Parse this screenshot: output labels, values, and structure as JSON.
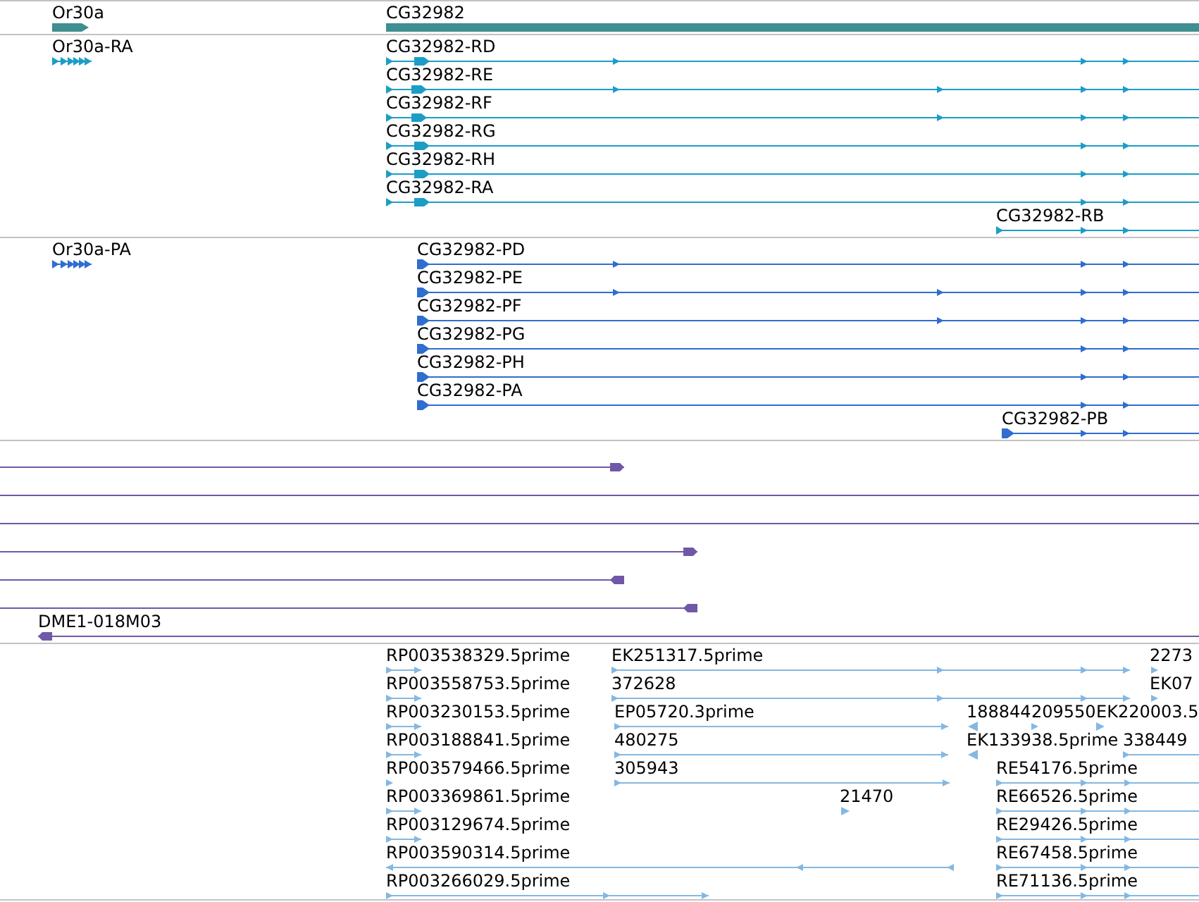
{
  "tracks": [
    {
      "kind": "gene",
      "features": [
        {
          "label": "Or30a"
        },
        {
          "label": "CG32982"
        }
      ]
    },
    {
      "kind": "transcript",
      "features": [
        {
          "label": "Or30a-RA"
        },
        {
          "label": "CG32982-RD"
        },
        {
          "label": "CG32982-RE"
        },
        {
          "label": "CG32982-RF"
        },
        {
          "label": "CG32982-RG"
        },
        {
          "label": "CG32982-RH"
        },
        {
          "label": "CG32982-RA"
        },
        {
          "label": "CG32982-RB"
        }
      ]
    },
    {
      "kind": "protein",
      "features": [
        {
          "label": "Or30a-PA"
        },
        {
          "label": "CG32982-PD"
        },
        {
          "label": "CG32982-PE"
        },
        {
          "label": "CG32982-PF"
        },
        {
          "label": "CG32982-PG"
        },
        {
          "label": "CG32982-PH"
        },
        {
          "label": "CG32982-PA"
        },
        {
          "label": "CG32982-PB"
        }
      ]
    },
    {
      "kind": "clone",
      "features": [
        {
          "kind": "forward"
        },
        {
          "kind": "through"
        },
        {
          "kind": "through"
        },
        {
          "kind": "forward"
        },
        {
          "kind": "reverse"
        },
        {
          "kind": "reverse"
        },
        {
          "kind": "reverse",
          "label": "DME1-018M03"
        }
      ]
    },
    {
      "kind": "est",
      "features": [
        {
          "kind": "forward",
          "label": "RP003538329.5prime"
        },
        {
          "kind": "forward",
          "label": "EK251317.5prime"
        },
        {
          "kind": "forward",
          "label": "2273"
        },
        {
          "kind": "forward",
          "label": "RP003558753.5prime"
        },
        {
          "kind": "forward",
          "label": "372628"
        },
        {
          "kind": "forward",
          "label": "EK07"
        },
        {
          "kind": "forward",
          "label": "RP003230153.5prime"
        },
        {
          "kind": "forward",
          "label": "EP05720.3prime"
        },
        {
          "kind": "reverse",
          "label": "188844"
        },
        {
          "kind": "forward",
          "label": "209550"
        },
        {
          "kind": "forward",
          "label": "EK220003.5"
        },
        {
          "kind": "forward",
          "label": "RP003188841.5prime"
        },
        {
          "kind": "forward",
          "label": "480275"
        },
        {
          "kind": "reverse",
          "label": "EK133938.5prime"
        },
        {
          "kind": "forward",
          "label": "338449"
        },
        {
          "kind": "forward",
          "label": "RP003579466.5prime"
        },
        {
          "kind": "forward",
          "label": "305943"
        },
        {
          "kind": "forward",
          "label": "RE54176.5prime"
        },
        {
          "kind": "forward",
          "label": "RP003369861.5prime"
        },
        {
          "kind": "forward",
          "label": "21470"
        },
        {
          "kind": "forward",
          "label": "RE66526.5prime"
        },
        {
          "kind": "forward",
          "label": "RP003129674.5prime"
        },
        {
          "kind": "forward",
          "label": "RE29426.5prime"
        },
        {
          "kind": "reverse",
          "label": "RP003590314.5prime"
        },
        {
          "kind": "forward",
          "label": "RE67458.5prime"
        },
        {
          "kind": "forward",
          "label": "RP003266029.5prime"
        },
        {
          "kind": "forward",
          "label": "RE71136.5prime"
        }
      ]
    }
  ]
}
